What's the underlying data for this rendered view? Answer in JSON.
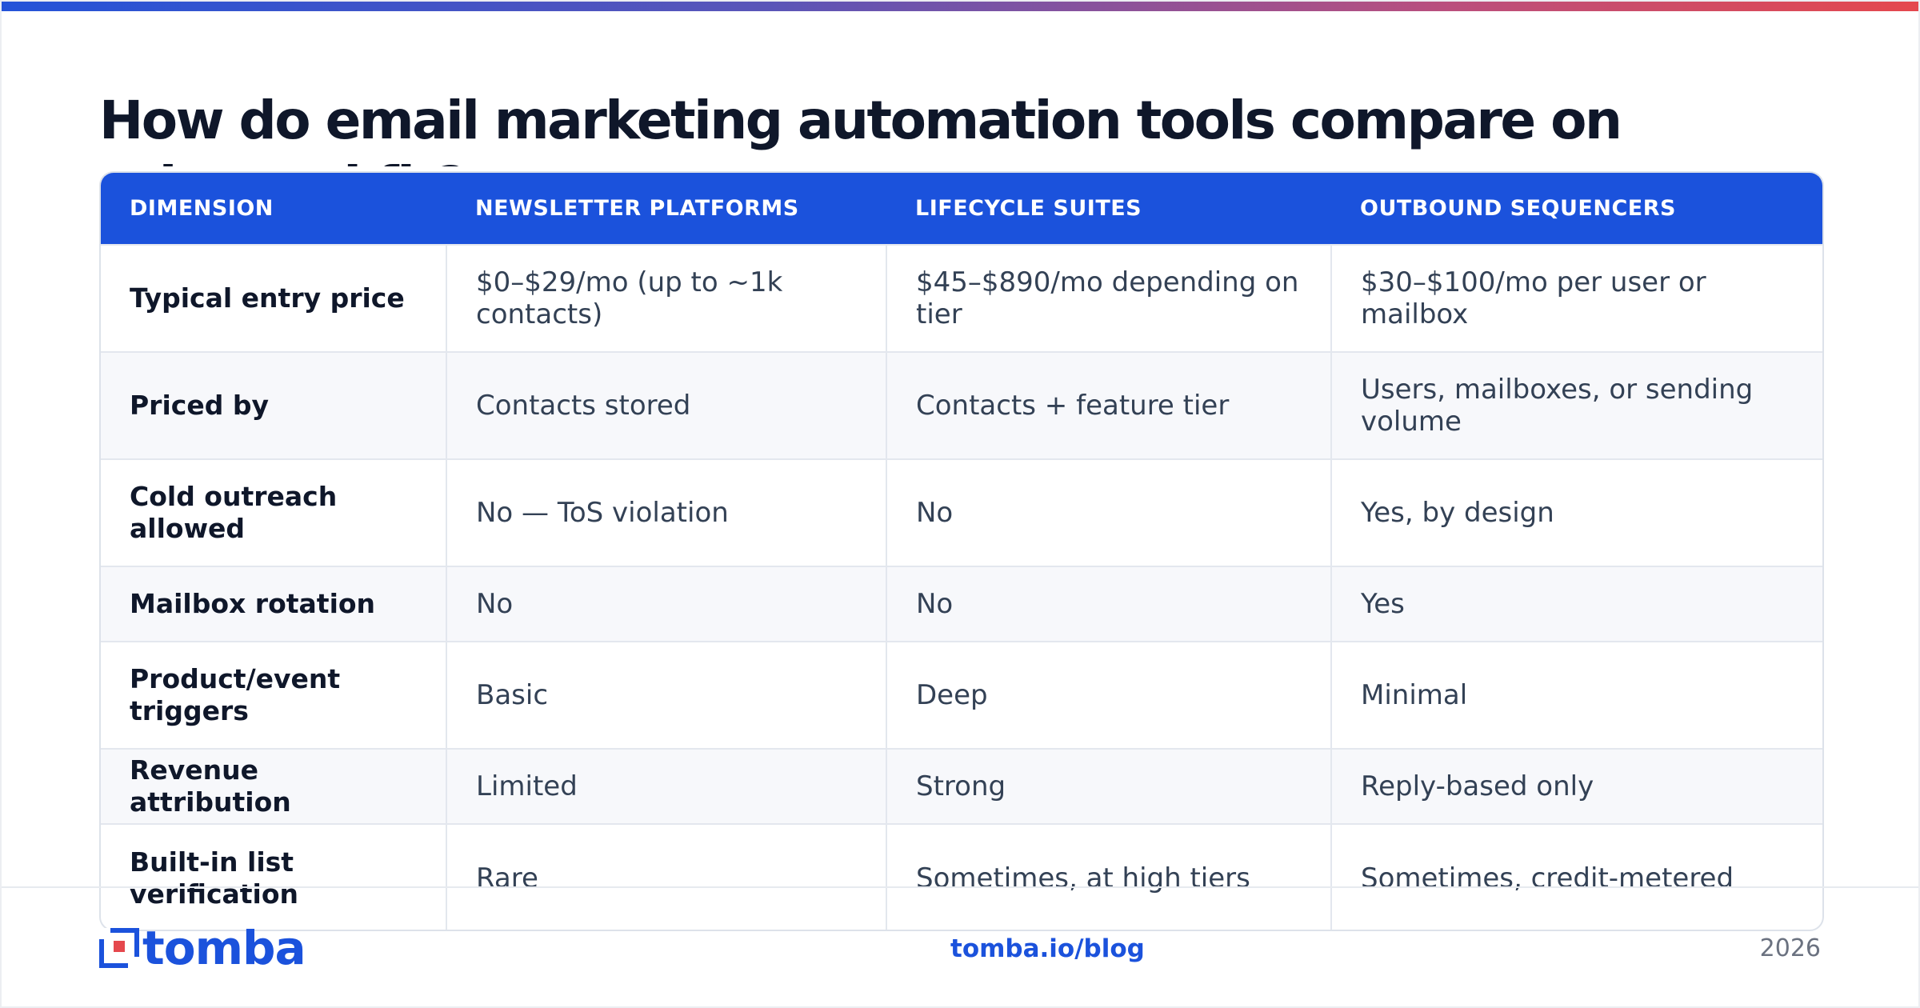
{
  "title": "How do email marketing automation tools compare on price and fit?",
  "table": {
    "headers": [
      "DIMENSION",
      "NEWSLETTER PLATFORMS",
      "LIFECYCLE SUITES",
      "OUTBOUND SEQUENCERS"
    ],
    "rows": [
      [
        "Typical entry price",
        "$0–$29/mo (up to ~1k contacts)",
        "$45–$890/mo depending on tier",
        "$30–$100/mo per user or mailbox"
      ],
      [
        "Priced by",
        "Contacts stored",
        "Contacts + feature tier",
        "Users, mailboxes, or sending volume"
      ],
      [
        "Cold outreach allowed",
        "No — ToS violation",
        "No",
        "Yes, by design"
      ],
      [
        "Mailbox rotation",
        "No",
        "No",
        "Yes"
      ],
      [
        "Product/event triggers",
        "Basic",
        "Deep",
        "Minimal"
      ],
      [
        "Revenue attribution",
        "Limited",
        "Strong",
        "Reply-based only"
      ],
      [
        "Built-in list verification",
        "Rare",
        "Sometimes, at high tiers",
        "Sometimes, credit-metered"
      ]
    ]
  },
  "footer": {
    "logo_text": "tomba",
    "link": "tomba.io/blog",
    "year": "2026"
  },
  "colors": {
    "accent": "#1b52dc",
    "title": "#0f172a",
    "body_text": "#334155",
    "stripe": "#f7f8fb",
    "logo_red": "#e5484d"
  },
  "icons": {
    "logo": "tomba-logo-icon"
  }
}
